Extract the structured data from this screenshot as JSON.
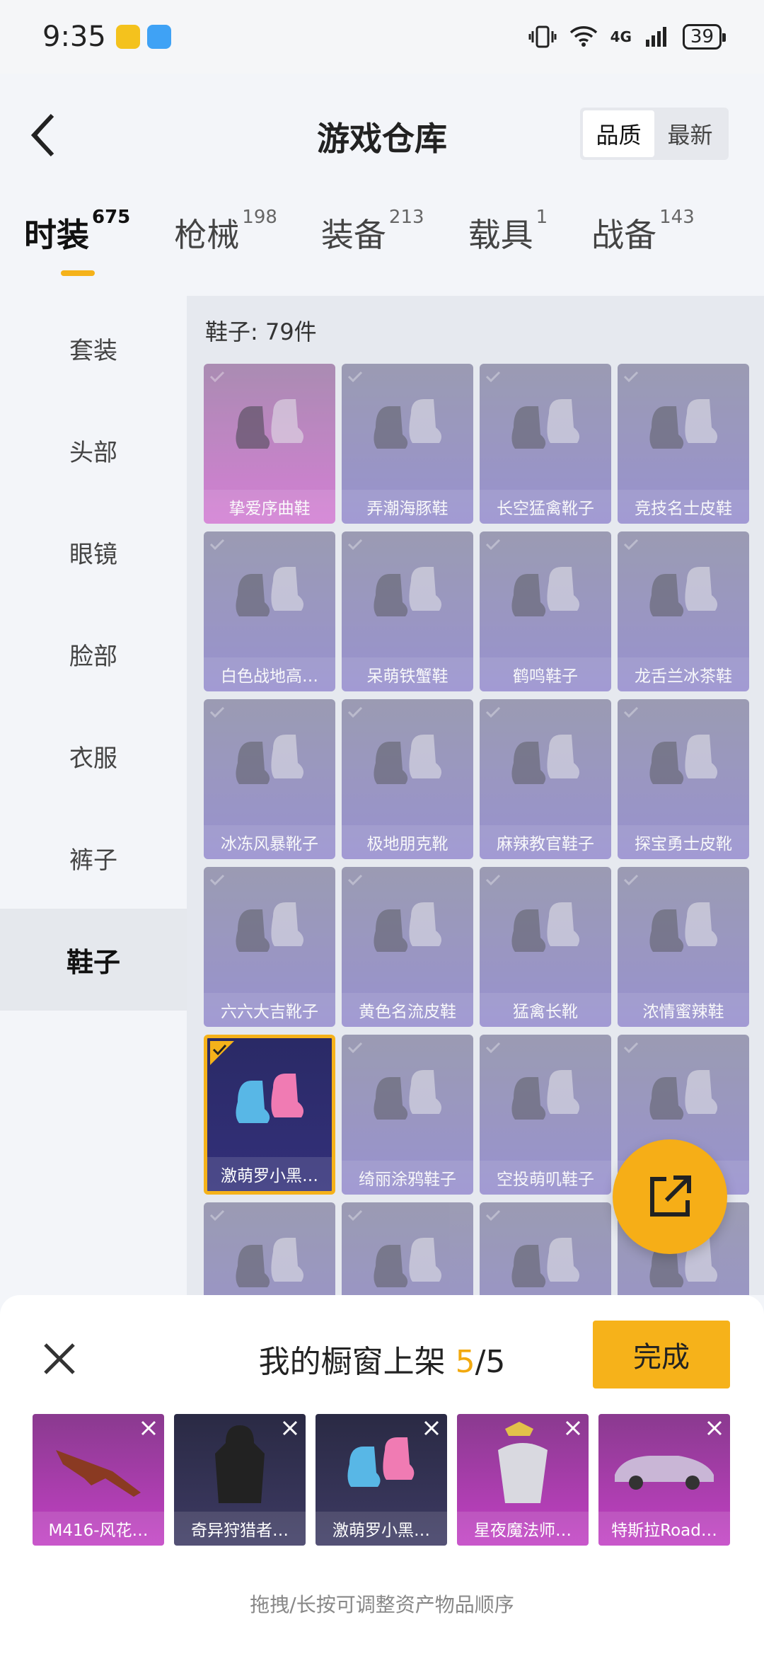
{
  "status_bar": {
    "time": "9:35",
    "network": "4G",
    "battery": "39"
  },
  "header": {
    "back_icon": "chevron-left-icon",
    "title": "游戏仓库",
    "sort": {
      "quality": "品质",
      "newest": "最新",
      "selected": "品质"
    }
  },
  "category_tabs": [
    {
      "label": "时装",
      "count": "675",
      "active": true
    },
    {
      "label": "枪械",
      "count": "198"
    },
    {
      "label": "装备",
      "count": "213"
    },
    {
      "label": "载具",
      "count": "1"
    },
    {
      "label": "战备",
      "count": "143"
    }
  ],
  "sub_nav": [
    {
      "label": "套装"
    },
    {
      "label": "头部"
    },
    {
      "label": "眼镜"
    },
    {
      "label": "脸部"
    },
    {
      "label": "衣服"
    },
    {
      "label": "裤子"
    },
    {
      "label": "鞋子",
      "active": true
    }
  ],
  "content": {
    "heading": "鞋子: 79件",
    "items": [
      {
        "name": "挚爱序曲鞋",
        "style": "pink"
      },
      {
        "name": "弄潮海豚鞋"
      },
      {
        "name": "长空猛禽靴子"
      },
      {
        "name": "竞技名士皮鞋"
      },
      {
        "name": "白色战地高…"
      },
      {
        "name": "呆萌铁蟹鞋"
      },
      {
        "name": "鹤鸣鞋子"
      },
      {
        "name": "龙舌兰冰茶鞋"
      },
      {
        "name": "冰冻风暴靴子"
      },
      {
        "name": "极地朋克靴"
      },
      {
        "name": "麻辣教官鞋子"
      },
      {
        "name": "探宝勇士皮靴"
      },
      {
        "name": "六六大吉靴子"
      },
      {
        "name": "黄色名流皮鞋"
      },
      {
        "name": "猛禽长靴"
      },
      {
        "name": "浓情蜜辣鞋"
      },
      {
        "name": "激萌罗小黑…",
        "style": "selected"
      },
      {
        "name": "绮丽涂鸦鞋子"
      },
      {
        "name": "空投萌叽鞋子"
      },
      {
        "name": ""
      },
      {
        "name": ""
      },
      {
        "name": ""
      },
      {
        "name": ""
      },
      {
        "name": ""
      }
    ]
  },
  "fab": {
    "icon": "share-export-icon"
  },
  "sheet": {
    "title_prefix": "我的橱窗上架 ",
    "count": "5",
    "total": "/5",
    "done": "完成",
    "items": [
      {
        "name": "M416-风花…"
      },
      {
        "name": "奇异狩猎者…",
        "style": "dark"
      },
      {
        "name": "激萌罗小黑…",
        "style": "dark"
      },
      {
        "name": "星夜魔法师…"
      },
      {
        "name": "特斯拉Road…"
      }
    ],
    "hint": "拖拽/长按可调整资产物品顺序"
  },
  "colors": {
    "accent": "#f5b21a",
    "item_purple": "#7b6fc4",
    "item_pink": "#d16dd0"
  }
}
